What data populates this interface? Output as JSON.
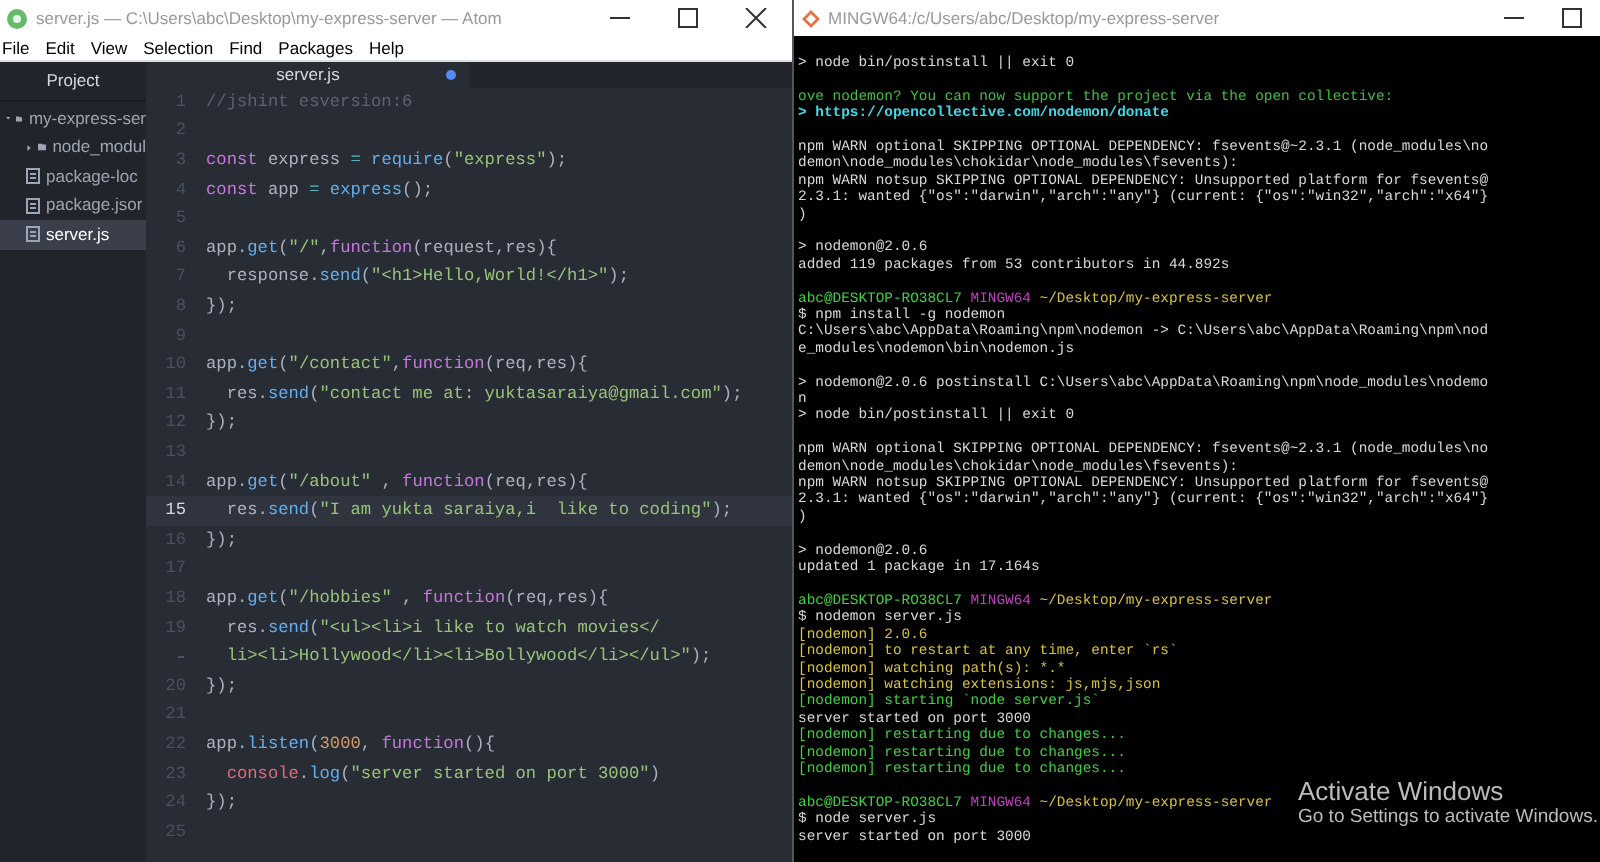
{
  "editor_window": {
    "title": "server.js — C:\\Users\\abc\\Desktop\\my-express-server — Atom",
    "menu": [
      "File",
      "Edit",
      "View",
      "Selection",
      "Find",
      "Packages",
      "Help"
    ],
    "sidebar": {
      "title": "Project",
      "tree": [
        {
          "label": "my-express-ser",
          "kind": "folder",
          "expanded": true,
          "selected": false,
          "children": [
            {
              "label": "node_modul",
              "kind": "folder",
              "expanded": false,
              "selected": false
            },
            {
              "label": "package-loc",
              "kind": "file",
              "selected": false
            },
            {
              "label": "package.jsor",
              "kind": "file",
              "selected": false
            },
            {
              "label": "server.js",
              "kind": "file",
              "selected": true
            }
          ]
        }
      ]
    },
    "tab": {
      "label": "server.js",
      "modified": true
    },
    "lines": [
      {
        "number": "1",
        "current": false,
        "tokens": [
          {
            "kind": "cmt",
            "text": "//jshint esversion:6"
          }
        ]
      },
      {
        "number": "2",
        "current": false
      },
      {
        "number": "3",
        "current": false,
        "tokens": [
          {
            "kind": "kw",
            "text": "const"
          },
          {
            "kind": "plain",
            "text": " express "
          },
          {
            "kind": "op",
            "text": "= "
          },
          {
            "kind": "fn",
            "text": "require"
          },
          {
            "kind": "plain",
            "text": "("
          },
          {
            "kind": "str",
            "text": "\"express\""
          },
          {
            "kind": "plain",
            "text": ");"
          }
        ]
      },
      {
        "number": "4",
        "current": false,
        "tokens": [
          {
            "kind": "kw",
            "text": "const"
          },
          {
            "kind": "plain",
            "text": " app "
          },
          {
            "kind": "op",
            "text": "= "
          },
          {
            "kind": "fn",
            "text": "express"
          },
          {
            "kind": "plain",
            "text": "();"
          }
        ]
      },
      {
        "number": "5",
        "current": false
      },
      {
        "number": "6",
        "current": false,
        "tokens": [
          {
            "kind": "plain",
            "text": "app."
          },
          {
            "kind": "fn",
            "text": "get"
          },
          {
            "kind": "plain",
            "text": "("
          },
          {
            "kind": "str",
            "text": "\"/\""
          },
          {
            "kind": "plain",
            "text": ","
          },
          {
            "kind": "kw",
            "text": "function"
          },
          {
            "kind": "plain",
            "text": "(request,res){"
          }
        ]
      },
      {
        "number": "7",
        "current": false,
        "tokens": [
          {
            "kind": "plain",
            "text": "  response."
          },
          {
            "kind": "fn",
            "text": "send"
          },
          {
            "kind": "plain",
            "text": "("
          },
          {
            "kind": "str",
            "text": "\"<h1>Hello,World!</h1>\""
          },
          {
            "kind": "plain",
            "text": ");"
          }
        ]
      },
      {
        "number": "8",
        "current": false,
        "tokens": [
          {
            "kind": "plain",
            "text": "});"
          }
        ]
      },
      {
        "number": "9",
        "current": false
      },
      {
        "number": "10",
        "current": false,
        "tokens": [
          {
            "kind": "plain",
            "text": "app."
          },
          {
            "kind": "fn",
            "text": "get"
          },
          {
            "kind": "plain",
            "text": "("
          },
          {
            "kind": "str",
            "text": "\"/contact\""
          },
          {
            "kind": "plain",
            "text": ","
          },
          {
            "kind": "kw",
            "text": "function"
          },
          {
            "kind": "plain",
            "text": "(req,res){"
          }
        ]
      },
      {
        "number": "11",
        "current": false,
        "tokens": [
          {
            "kind": "plain",
            "text": "  res."
          },
          {
            "kind": "fn",
            "text": "send"
          },
          {
            "kind": "plain",
            "text": "("
          },
          {
            "kind": "str",
            "text": "\"contact me at: yuktasaraiya@gmail.com\""
          },
          {
            "kind": "plain",
            "text": ");"
          }
        ]
      },
      {
        "number": "12",
        "current": false,
        "tokens": [
          {
            "kind": "plain",
            "text": "});"
          }
        ]
      },
      {
        "number": "13",
        "current": false
      },
      {
        "number": "14",
        "current": false,
        "tokens": [
          {
            "kind": "plain",
            "text": "app."
          },
          {
            "kind": "fn",
            "text": "get"
          },
          {
            "kind": "plain",
            "text": "("
          },
          {
            "kind": "str",
            "text": "\"/about\""
          },
          {
            "kind": "plain",
            "text": " , "
          },
          {
            "kind": "kw",
            "text": "function"
          },
          {
            "kind": "plain",
            "text": "(req,res){"
          }
        ]
      },
      {
        "number": "15",
        "current": true,
        "tokens": [
          {
            "kind": "plain",
            "text": "  res."
          },
          {
            "kind": "fn",
            "text": "send"
          },
          {
            "kind": "plain",
            "text": "("
          },
          {
            "kind": "str",
            "text": "\"I am yukta saraiya,i  like to coding\""
          },
          {
            "kind": "plain",
            "text": ");"
          }
        ]
      },
      {
        "number": "16",
        "current": false,
        "tokens": [
          {
            "kind": "plain",
            "text": "});"
          }
        ]
      },
      {
        "number": "17",
        "current": false
      },
      {
        "number": "18",
        "current": false,
        "tokens": [
          {
            "kind": "plain",
            "text": "app."
          },
          {
            "kind": "fn",
            "text": "get"
          },
          {
            "kind": "plain",
            "text": "("
          },
          {
            "kind": "str",
            "text": "\"/hobbies\""
          },
          {
            "kind": "plain",
            "text": " , "
          },
          {
            "kind": "kw",
            "text": "function"
          },
          {
            "kind": "plain",
            "text": "(req,res){"
          }
        ]
      },
      {
        "number": "19",
        "current": false,
        "tokens": [
          {
            "kind": "plain",
            "text": "  res."
          },
          {
            "kind": "fn",
            "text": "send"
          },
          {
            "kind": "plain",
            "text": "("
          },
          {
            "kind": "str",
            "text": "\"<ul><li>i like to watch movies</"
          }
        ],
        "continuation": [
          {
            "kind": "str",
            "text": "  li><li>Hollywood</li><li>Bollywood</li></ul>\""
          },
          {
            "kind": "plain",
            "text": ");"
          }
        ]
      },
      {
        "number": "20",
        "current": false,
        "tokens": [
          {
            "kind": "plain",
            "text": "});"
          }
        ]
      },
      {
        "number": "21",
        "current": false
      },
      {
        "number": "22",
        "current": false,
        "tokens": [
          {
            "kind": "plain",
            "text": "app."
          },
          {
            "kind": "fn",
            "text": "listen"
          },
          {
            "kind": "plain",
            "text": "("
          },
          {
            "kind": "num",
            "text": "3000"
          },
          {
            "kind": "plain",
            "text": ", "
          },
          {
            "kind": "kw",
            "text": "function"
          },
          {
            "kind": "plain",
            "text": "(){"
          }
        ]
      },
      {
        "number": "23",
        "current": false,
        "tokens": [
          {
            "kind": "obj",
            "text": "  console"
          },
          {
            "kind": "plain",
            "text": "."
          },
          {
            "kind": "fn",
            "text": "log"
          },
          {
            "kind": "plain",
            "text": "("
          },
          {
            "kind": "str",
            "text": "\"server started on port 3000\""
          },
          {
            "kind": "plain",
            "text": ")"
          }
        ]
      },
      {
        "number": "24",
        "current": false,
        "tokens": [
          {
            "kind": "plain",
            "text": "});"
          }
        ]
      },
      {
        "number": "25",
        "current": false
      }
    ]
  },
  "terminal_window": {
    "title": "MINGW64:/c/Users/abc/Desktop/my-express-server",
    "lines": [
      {
        "spaced": false,
        "segments": [
          {
            "kind": "plain",
            "text": "> node bin/postinstall || exit 0"
          }
        ]
      },
      {
        "spaced": true,
        "segments": [
          {
            "kind": "notice",
            "text": "ove nodemon? You can now support the project via the open collective:"
          }
        ]
      },
      {
        "spaced": false,
        "segments": [
          {
            "kind": "link",
            "text": "> https://opencollective.com/nodemon/donate"
          }
        ]
      },
      {
        "spaced": true,
        "segments": [
          {
            "kind": "plain",
            "text": "npm WARN optional SKIPPING OPTIONAL DEPENDENCY: fsevents@~2.3.1 (node_modules\\no"
          }
        ]
      },
      {
        "spaced": false,
        "segments": [
          {
            "kind": "plain",
            "text": "demon\\node_modules\\chokidar\\node_modules\\fsevents):"
          }
        ]
      },
      {
        "spaced": false,
        "segments": [
          {
            "kind": "plain",
            "text": "npm WARN notsup SKIPPING OPTIONAL DEPENDENCY: Unsupported platform for fsevents@"
          }
        ]
      },
      {
        "spaced": false,
        "segments": [
          {
            "kind": "plain",
            "text": "2.3.1: wanted {\"os\":\"darwin\",\"arch\":\"any\"} (current: {\"os\":\"win32\",\"arch\":\"x64\"}"
          }
        ]
      },
      {
        "spaced": false,
        "segments": [
          {
            "kind": "plain",
            "text": ")"
          }
        ]
      },
      {
        "spaced": true,
        "segments": [
          {
            "kind": "plain",
            "text": "> nodemon@2.0.6"
          }
        ]
      },
      {
        "spaced": false,
        "segments": [
          {
            "kind": "plain",
            "text": "added 119 packages from 53 contributors in 44.892s"
          }
        ]
      },
      {
        "spaced": true,
        "segments": [
          {
            "kind": "user",
            "text": "abc@DESKTOP-RO38CL7"
          },
          {
            "kind": "host",
            "text": "MINGW64"
          },
          {
            "kind": "path",
            "text": "~/Desktop/my-express-server"
          }
        ]
      },
      {
        "spaced": false,
        "segments": [
          {
            "kind": "plain",
            "text": "$ npm install -g nodemon"
          }
        ]
      },
      {
        "spaced": false,
        "segments": [
          {
            "kind": "plain",
            "text": "C:\\Users\\abc\\AppData\\Roaming\\npm\\nodemon -> C:\\Users\\abc\\AppData\\Roaming\\npm\\nod"
          }
        ]
      },
      {
        "spaced": false,
        "segments": [
          {
            "kind": "plain",
            "text": "e_modules\\nodemon\\bin\\nodemon.js"
          }
        ]
      },
      {
        "spaced": true,
        "segments": [
          {
            "kind": "plain",
            "text": "> nodemon@2.0.6 postinstall C:\\Users\\abc\\AppData\\Roaming\\npm\\node_modules\\nodemo"
          }
        ]
      },
      {
        "spaced": false,
        "segments": [
          {
            "kind": "plain",
            "text": "n"
          }
        ]
      },
      {
        "spaced": false,
        "segments": [
          {
            "kind": "plain",
            "text": "> node bin/postinstall || exit 0"
          }
        ]
      },
      {
        "spaced": true,
        "segments": [
          {
            "kind": "plain",
            "text": "npm WARN optional SKIPPING OPTIONAL DEPENDENCY: fsevents@~2.3.1 (node_modules\\no"
          }
        ]
      },
      {
        "spaced": false,
        "segments": [
          {
            "kind": "plain",
            "text": "demon\\node_modules\\chokidar\\node_modules\\fsevents):"
          }
        ]
      },
      {
        "spaced": false,
        "segments": [
          {
            "kind": "plain",
            "text": "npm WARN notsup SKIPPING OPTIONAL DEPENDENCY: Unsupported platform for fsevents@"
          }
        ]
      },
      {
        "spaced": false,
        "segments": [
          {
            "kind": "plain",
            "text": "2.3.1: wanted {\"os\":\"darwin\",\"arch\":\"any\"} (current: {\"os\":\"win32\",\"arch\":\"x64\"}"
          }
        ]
      },
      {
        "spaced": false,
        "segments": [
          {
            "kind": "plain",
            "text": ")"
          }
        ]
      },
      {
        "spaced": true,
        "segments": [
          {
            "kind": "plain",
            "text": "> nodemon@2.0.6"
          }
        ]
      },
      {
        "spaced": false,
        "segments": [
          {
            "kind": "plain",
            "text": "updated 1 package in 17.164s"
          }
        ]
      },
      {
        "spaced": true,
        "segments": [
          {
            "kind": "user",
            "text": "abc@DESKTOP-RO38CL7"
          },
          {
            "kind": "host",
            "text": "MINGW64"
          },
          {
            "kind": "path",
            "text": "~/Desktop/my-express-server"
          }
        ]
      },
      {
        "spaced": false,
        "segments": [
          {
            "kind": "plain",
            "text": "$ nodemon server.js"
          }
        ]
      },
      {
        "spaced": false,
        "segments": [
          {
            "kind": "info",
            "text": "[nodemon] 2.0.6"
          }
        ]
      },
      {
        "spaced": false,
        "segments": [
          {
            "kind": "info",
            "text": "[nodemon] to restart at any time, enter `rs`"
          }
        ]
      },
      {
        "spaced": false,
        "segments": [
          {
            "kind": "info",
            "text": "[nodemon] watching path(s): *.*"
          }
        ]
      },
      {
        "spaced": false,
        "segments": [
          {
            "kind": "info",
            "text": "[nodemon] watching extensions: js,mjs,json"
          }
        ]
      },
      {
        "spaced": false,
        "segments": [
          {
            "kind": "status",
            "text": "[nodemon] starting `node server.js`"
          }
        ]
      },
      {
        "spaced": false,
        "segments": [
          {
            "kind": "plain",
            "text": "server started on port 3000"
          }
        ]
      },
      {
        "spaced": false,
        "segments": [
          {
            "kind": "status",
            "text": "[nodemon] restarting due to changes..."
          }
        ]
      },
      {
        "spaced": false,
        "segments": [
          {
            "kind": "status",
            "text": "[nodemon] restarting due to changes..."
          }
        ]
      },
      {
        "spaced": false,
        "segments": [
          {
            "kind": "status",
            "text": "[nodemon] restarting due to changes..."
          }
        ]
      },
      {
        "spaced": true,
        "segments": [
          {
            "kind": "user",
            "text": "abc@DESKTOP-RO38CL7"
          },
          {
            "kind": "host",
            "text": "MINGW64"
          },
          {
            "kind": "path",
            "text": "~/Desktop/my-express-server"
          }
        ]
      },
      {
        "spaced": false,
        "segments": [
          {
            "kind": "plain",
            "text": "$ node server.js"
          }
        ]
      },
      {
        "spaced": false,
        "segments": [
          {
            "kind": "plain",
            "text": "server started on port 3000"
          }
        ]
      }
    ]
  },
  "activation_notice": {
    "title": "Activate Windows",
    "message": "Go to Settings to activate Windows."
  }
}
